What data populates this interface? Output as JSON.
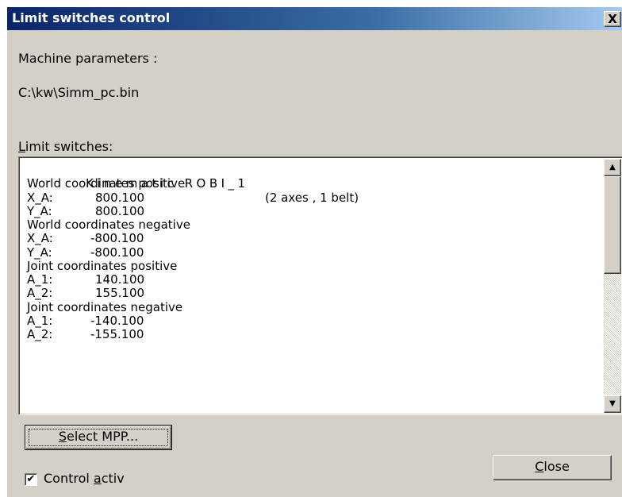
{
  "window": {
    "title": "Limit switches control",
    "close_glyph": "X"
  },
  "machine": {
    "label": "Machine parameters :",
    "path": "C:\\kw\\Simm_pc.bin"
  },
  "limits": {
    "label_mnemonic": "L",
    "label_rest": "imit switches:",
    "heading": "Kinematic ROBI_1",
    "heading_info": "(2 axes , 1 belt)",
    "lines": [
      {
        "type": "section",
        "text": "World coordinates positive"
      },
      {
        "type": "value",
        "axis": "X_A:",
        "value": "800.100"
      },
      {
        "type": "value",
        "axis": "Y_A:",
        "value": "800.100"
      },
      {
        "type": "section",
        "text": "World coordinates negative"
      },
      {
        "type": "value",
        "axis": "X_A:",
        "value": "-800.100"
      },
      {
        "type": "value",
        "axis": "Y_A:",
        "value": "-800.100"
      },
      {
        "type": "section",
        "text": "Joint coordinates positive"
      },
      {
        "type": "value",
        "axis": "A_1:",
        "value": "140.100"
      },
      {
        "type": "value",
        "axis": "A_2:",
        "value": "155.100"
      },
      {
        "type": "section",
        "text": "Joint coordinates negative"
      },
      {
        "type": "value",
        "axis": "A_1:",
        "value": "-140.100"
      },
      {
        "type": "value",
        "axis": "A_2:",
        "value": "-155.100"
      }
    ],
    "scroll_up_glyph": "▲",
    "scroll_down_glyph": "▼"
  },
  "buttons": {
    "select_mnemonic": "S",
    "select_rest": "elect MPP...",
    "close_mnemonic": "C",
    "close_rest": "lose"
  },
  "control": {
    "checked": true,
    "check_glyph": "✔",
    "label_before": "Control ",
    "label_mnemonic": "a",
    "label_after": "ctiv"
  }
}
